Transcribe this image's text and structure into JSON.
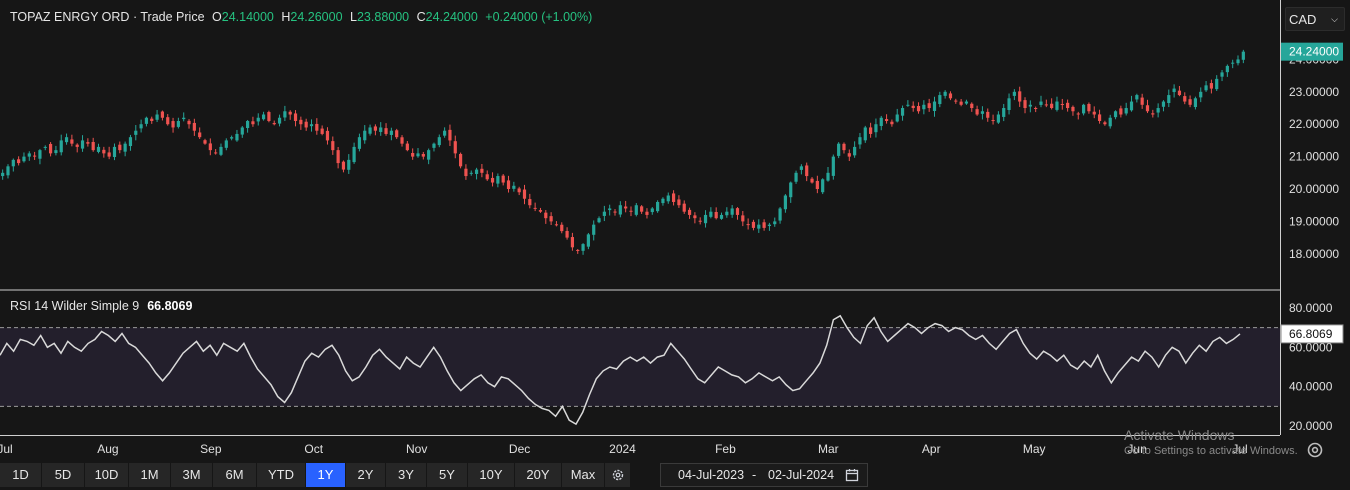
{
  "header": {
    "symbol": "TOPAZ ENRGY ORD",
    "separator": "·",
    "price_type": "Trade Price",
    "open_label": "O",
    "open": "24.14000",
    "high_label": "H",
    "high": "24.26000",
    "low_label": "L",
    "low": "23.88000",
    "close_label": "C",
    "close": "24.24000",
    "change": "+0.24000 (+1.00%)"
  },
  "currency": {
    "selected": "CAD"
  },
  "rsi": {
    "label": "RSI 14 Wilder Simple 9",
    "value": "66.8069"
  },
  "colors": {
    "up": "#26a69a",
    "down": "#ef5350",
    "rsi_line": "#d9d9d9",
    "rsi_band": "#231f2c",
    "active_range": "#2962ff",
    "price_tag": "#26a69a"
  },
  "ranges": [
    "1D",
    "5D",
    "10D",
    "1M",
    "3M",
    "6M",
    "YTD",
    "1Y",
    "2Y",
    "3Y",
    "5Y",
    "10Y",
    "20Y",
    "Max"
  ],
  "active_range": "1Y",
  "date_range": {
    "from": "04-Jul-2023",
    "separator": "-",
    "to": "02-Jul-2024",
    "icon": "calendar-icon"
  },
  "settings_icon": "gear-icon",
  "right_icon": "settings-icon",
  "watermark": {
    "line1": "Activate Windows",
    "line2": "Go to Settings to activate Windows."
  },
  "chart_data": [
    {
      "type": "candlestick",
      "title": "TOPAZ ENRGY ORD · Trade Price",
      "x_labels": [
        "Jul",
        "Aug",
        "Sep",
        "Oct",
        "Nov",
        "Dec",
        "2024",
        "Feb",
        "Mar",
        "Apr",
        "May",
        "Jun",
        "Jul"
      ],
      "y_ticks": [
        "18.00000",
        "19.00000",
        "20.00000",
        "21.00000",
        "22.00000",
        "23.00000",
        "24.00000"
      ],
      "ylim": [
        17.5,
        24.6
      ],
      "last_price": "24.24000",
      "close_series": [
        20.5,
        20.7,
        20.9,
        20.8,
        21.0,
        21.1,
        21.0,
        21.2,
        21.3,
        21.1,
        21.2,
        21.5,
        21.6,
        21.4,
        21.3,
        21.5,
        21.4,
        21.2,
        21.3,
        21.1,
        21.0,
        21.3,
        21.2,
        21.4,
        21.6,
        21.8,
        22.0,
        22.2,
        22.1,
        22.3,
        22.2,
        22.0,
        21.9,
        22.1,
        22.2,
        22.0,
        21.8,
        21.6,
        21.4,
        21.2,
        21.1,
        21.3,
        21.5,
        21.6,
        21.7,
        21.9,
        22.1,
        22.0,
        22.2,
        22.3,
        22.1,
        22.0,
        22.2,
        22.4,
        22.3,
        22.1,
        22.0,
        21.9,
        22.0,
        21.8,
        21.7,
        21.5,
        21.2,
        20.8,
        20.6,
        20.9,
        21.3,
        21.6,
        21.8,
        21.9,
        21.8,
        21.9,
        21.7,
        21.8,
        21.6,
        21.4,
        21.2,
        21.0,
        21.1,
        21.0,
        21.2,
        21.4,
        21.6,
        21.8,
        21.5,
        21.1,
        20.7,
        20.4,
        20.5,
        20.6,
        20.5,
        20.3,
        20.2,
        20.4,
        20.2,
        20.0,
        20.1,
        19.9,
        19.7,
        19.5,
        19.4,
        19.3,
        19.1,
        19.0,
        18.9,
        18.7,
        18.5,
        18.2,
        18.1,
        18.3,
        18.6,
        18.9,
        19.1,
        19.3,
        19.4,
        19.3,
        19.5,
        19.4,
        19.3,
        19.5,
        19.3,
        19.2,
        19.4,
        19.6,
        19.7,
        19.8,
        19.6,
        19.5,
        19.3,
        19.2,
        19.1,
        19.0,
        19.2,
        19.3,
        19.1,
        19.2,
        19.3,
        19.4,
        19.2,
        19.0,
        18.9,
        18.8,
        18.9,
        18.8,
        18.9,
        19.0,
        19.4,
        19.8,
        20.2,
        20.5,
        20.7,
        20.4,
        20.2,
        20.0,
        20.3,
        20.5,
        21.0,
        21.4,
        21.2,
        21.0,
        21.3,
        21.6,
        21.9,
        21.7,
        22.0,
        22.2,
        22.1,
        22.0,
        22.3,
        22.5,
        22.6,
        22.5,
        22.4,
        22.6,
        22.5,
        22.7,
        22.9,
        23.0,
        22.8,
        22.7,
        22.6,
        22.7,
        22.5,
        22.3,
        22.4,
        22.2,
        22.1,
        22.3,
        22.5,
        22.8,
        23.0,
        22.7,
        22.5,
        22.6,
        22.5,
        22.7,
        22.6,
        22.5,
        22.7,
        22.6,
        22.5,
        22.4,
        22.3,
        22.6,
        22.4,
        22.3,
        22.1,
        22.0,
        22.2,
        22.4,
        22.3,
        22.5,
        22.7,
        22.9,
        22.6,
        22.4,
        22.3,
        22.5,
        22.7,
        22.9,
        23.1,
        22.9,
        22.7,
        22.6,
        22.8,
        23.0,
        23.2,
        23.1,
        23.4,
        23.6,
        23.8,
        23.9,
        24.0,
        24.24
      ]
    },
    {
      "type": "line",
      "title": "RSI 14 Wilder Simple 9",
      "x_labels": [
        "Jul",
        "Aug",
        "Sep",
        "Oct",
        "Nov",
        "Dec",
        "2024",
        "Feb",
        "Mar",
        "Apr",
        "May",
        "Jun",
        "Jul"
      ],
      "y_ticks": [
        "20.0000",
        "40.0000",
        "60.0000",
        "80.0000"
      ],
      "ylim": [
        16,
        84
      ],
      "reference_lines": [
        70,
        30
      ],
      "last_value": "66.8069",
      "series": [
        {
          "values": [
            56,
            62,
            58,
            64,
            63,
            61,
            66,
            60,
            62,
            57,
            63,
            60,
            58,
            62,
            64,
            68,
            66,
            63,
            67,
            62,
            60,
            56,
            52,
            47,
            43,
            47,
            52,
            57,
            60,
            63,
            58,
            61,
            56,
            62,
            60,
            58,
            62,
            55,
            49,
            45,
            41,
            35,
            32,
            37,
            45,
            53,
            57,
            55,
            59,
            61,
            56,
            48,
            43,
            45,
            50,
            56,
            59,
            55,
            52,
            49,
            55,
            52,
            50,
            55,
            60,
            55,
            48,
            42,
            38,
            41,
            44,
            46,
            42,
            40,
            45,
            44,
            41,
            38,
            34,
            31,
            29,
            28,
            25,
            30,
            23,
            21,
            27,
            36,
            44,
            48,
            50,
            49,
            53,
            55,
            53,
            55,
            52,
            55,
            56,
            62,
            58,
            54,
            49,
            44,
            42,
            46,
            50,
            48,
            46,
            45,
            42,
            44,
            47,
            45,
            43,
            45,
            41,
            38,
            39,
            43,
            47,
            52,
            61,
            74,
            76,
            70,
            65,
            62,
            71,
            75,
            68,
            63,
            66,
            69,
            72,
            70,
            67,
            70,
            72,
            71,
            68,
            70,
            69,
            66,
            64,
            66,
            62,
            59,
            63,
            67,
            69,
            62,
            57,
            54,
            58,
            56,
            53,
            56,
            51,
            49,
            53,
            50,
            56,
            48,
            42,
            47,
            51,
            55,
            53,
            58,
            55,
            50,
            56,
            60,
            58,
            52,
            57,
            61,
            58,
            63,
            65,
            62,
            64,
            66.8
          ]
        }
      ]
    }
  ]
}
